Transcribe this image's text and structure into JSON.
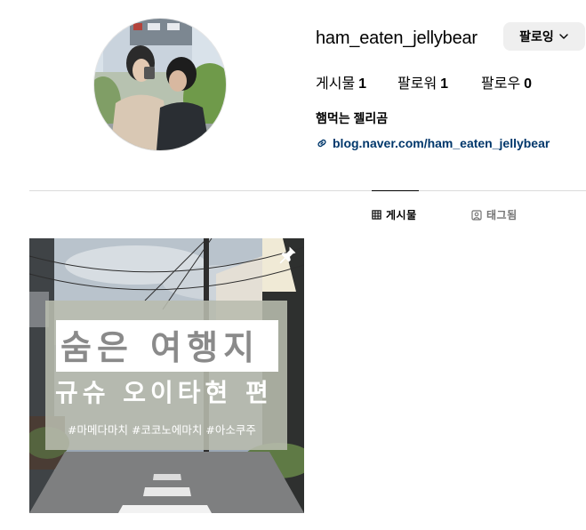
{
  "profile": {
    "username": "ham_eaten_jellybear",
    "follow_button_label": "팔로잉",
    "full_name": "햄먹는 젤리곰",
    "link_text": "blog.naver.com/ham_eaten_jellybear",
    "stats": [
      {
        "label": "게시물",
        "value": "1"
      },
      {
        "label": "팔로워",
        "value": "1"
      },
      {
        "label": "팔로우",
        "value": "0"
      }
    ]
  },
  "tabs": [
    {
      "label": "게시물",
      "icon": "grid-icon",
      "active": true
    },
    {
      "label": "태그됨",
      "icon": "tagged-icon",
      "active": false
    }
  ],
  "posts": [
    {
      "title_line1": "숨은 여행지",
      "title_line2": "규슈 오이타현 편",
      "hashtags": "#마메다마치 #코코노에마치 #아소쿠주",
      "pinned": true
    }
  ],
  "colors": {
    "link": "#00376b",
    "button_bg": "#efefef",
    "divider": "#dbdbdb",
    "tab_inactive": "#737373"
  }
}
